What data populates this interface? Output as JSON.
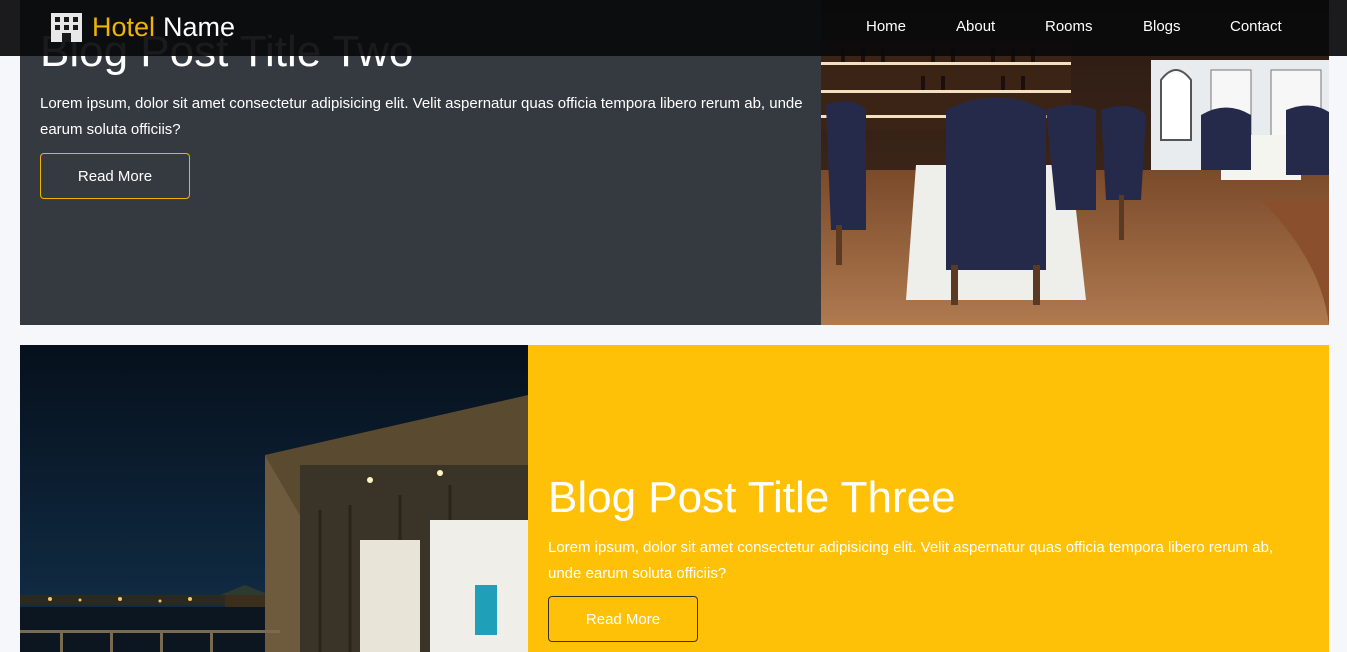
{
  "navbar": {
    "brand_accent": "Hotel",
    "brand_white": "Name",
    "brand_icon": "hotel-building-icon",
    "links": [
      "Home",
      "About",
      "Rooms",
      "Blogs",
      "Contact"
    ]
  },
  "posts": [
    {
      "title": "Blog Post Title Two",
      "excerpt": "Lorem ipsum, dolor sit amet consectetur adipisicing elit. Velit aspernatur quas officia tempora libero rerum ab, unde earum soluta officiis?",
      "button": "Read More",
      "image": "restaurant-dining-room-photo",
      "background": "#343a40"
    },
    {
      "title": "Blog Post Title Three",
      "excerpt": "Lorem ipsum, dolor sit amet consectetur adipisicing elit. Velit aspernatur quas officia tempora libero rerum ab, unde earum soluta officiis?",
      "button": "Read More",
      "image": "hotel-night-exterior-photo",
      "background": "#ffc107"
    }
  ],
  "colors": {
    "accent": "#f0b400",
    "navbar": "#0a0a0c",
    "page": "#f5f7fa"
  }
}
